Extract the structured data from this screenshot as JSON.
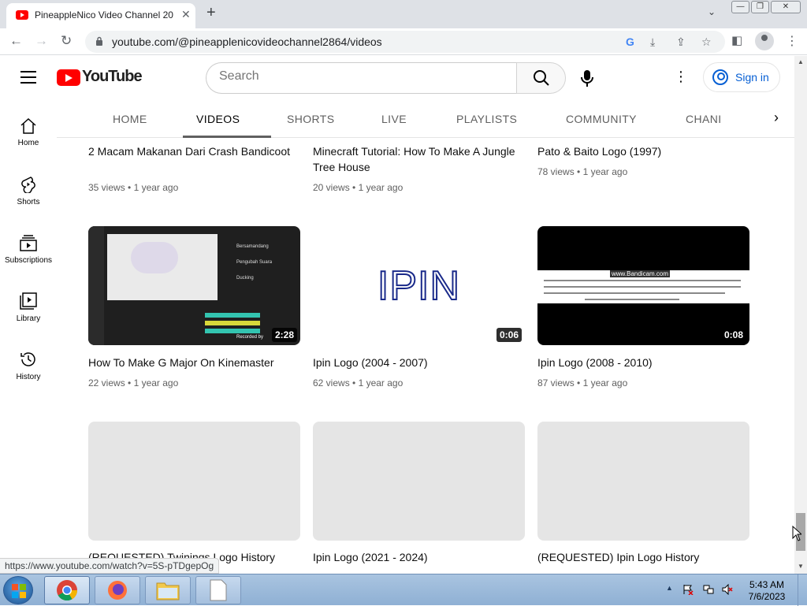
{
  "browser": {
    "tab_title": "PineappleNico Video Channel 20",
    "url": "youtube.com/@pineapplenicovideochannel2864/videos",
    "status_url": "https://www.youtube.com/watch?v=5S-pTDgepOg"
  },
  "masthead": {
    "logo_text": "YouTube",
    "search_placeholder": "Search",
    "signin_label": "Sign in"
  },
  "guide": [
    {
      "label": "Home",
      "icon": "home-icon"
    },
    {
      "label": "Shorts",
      "icon": "shorts-icon"
    },
    {
      "label": "Subscriptions",
      "icon": "subscriptions-icon"
    },
    {
      "label": "Library",
      "icon": "library-icon"
    },
    {
      "label": "History",
      "icon": "history-icon"
    }
  ],
  "channel_tabs": [
    {
      "label": "HOME"
    },
    {
      "label": "VIDEOS"
    },
    {
      "label": "SHORTS"
    },
    {
      "label": "LIVE"
    },
    {
      "label": "PLAYLISTS"
    },
    {
      "label": "COMMUNITY"
    },
    {
      "label": "CHANI"
    }
  ],
  "active_tab": "VIDEOS",
  "videos": [
    {
      "title": "2 Macam Makanan Dari Crash Bandicoot",
      "views": "35 views",
      "age": "1 year ago"
    },
    {
      "title": "Minecraft Tutorial: How To Make A Jungle Tree House",
      "views": "20 views",
      "age": "1 year ago"
    },
    {
      "title": "Pato & Baito Logo (1997)",
      "views": "78 views",
      "age": "1 year ago"
    },
    {
      "title": "How To Make G Major On Kinemaster",
      "views": "22 views",
      "age": "1 year ago",
      "duration": "2:28"
    },
    {
      "title": "Ipin Logo (2004 - 2007)",
      "views": "62 views",
      "age": "1 year ago",
      "duration": "0:06",
      "thumb_text": "IPIN"
    },
    {
      "title": "Ipin Logo (2008 - 2010)",
      "views": "87 views",
      "age": "1 year ago",
      "duration": "0:08",
      "thumb_text": "www.Bandicam.com"
    },
    {
      "title": "(REQUESTED) Twinings Logo History"
    },
    {
      "title": "Ipin Logo (2021 - 2024)"
    },
    {
      "title": "(REQUESTED) Ipin Logo History"
    }
  ],
  "thumb_ui": {
    "recorded_by": "Recorded by",
    "menu_items": [
      "Bersamandang",
      "Pengubah Suara",
      "Ducking"
    ]
  },
  "taskbar": {
    "time": "5:43 AM",
    "date": "7/6/2023"
  }
}
